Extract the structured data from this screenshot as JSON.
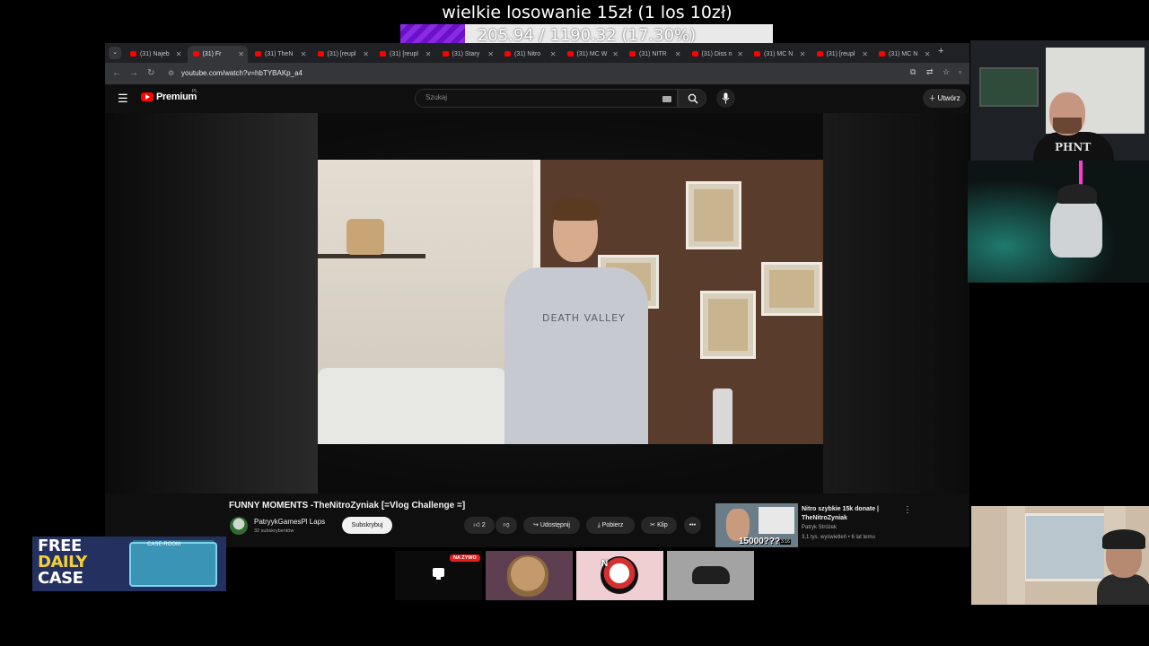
{
  "overlay": {
    "goal_title": "wielkie losowanie 15zł (1 los 10zł)",
    "goal_progress_text": "205.94 / 1190.32 (17.30%)",
    "goal_fraction": 0.173,
    "goal_bar_color": "#8a2be2"
  },
  "browser": {
    "tabs": [
      {
        "label": "(31) Najeb",
        "active": false
      },
      {
        "label": "(31) Fr",
        "active": true
      },
      {
        "label": "(31) TheN",
        "active": false
      },
      {
        "label": "(31) [reupl",
        "active": false
      },
      {
        "label": "(31) [reupl",
        "active": false
      },
      {
        "label": "(31) Stary",
        "active": false
      },
      {
        "label": "(31) Nitro",
        "active": false
      },
      {
        "label": "(31) MC W",
        "active": false
      },
      {
        "label": "(31) NITR",
        "active": false
      },
      {
        "label": "(31) Diss n",
        "active": false
      },
      {
        "label": "(31) MC N",
        "active": false
      },
      {
        "label": "(31) [reupl",
        "active": false
      },
      {
        "label": "(31) MC N",
        "active": false
      }
    ],
    "url": "youtube.com/watch?v=hbTYBAKp_a4"
  },
  "youtube": {
    "logo_text": "Premium",
    "logo_region": "PL",
    "search_placeholder": "Szukaj",
    "create_label": "Utwórz",
    "video": {
      "shirt_text": "DEATH VALLEY",
      "title": "FUNNY MOMENTS -TheNitroZyniak [=Vlog Challenge =]",
      "channel": "PatryykGamesPl Laps",
      "subscribers": "32 subskrybentów",
      "subscribe_label": "Subskrybuj",
      "likes": "2",
      "share_label": "Udostępnij",
      "download_label": "Pobierz",
      "clip_label": "Klip"
    },
    "recommendation": {
      "title": "Nitro szybkie 15k donate | TheNitroZyniak",
      "channel": "Patryk Stróżek",
      "meta": "3,1 tys. wyświetleń • 6 lat temu",
      "thumb_text": "15000???",
      "duration": "3:16"
    }
  },
  "webcams": {
    "cam1_shirt": "PHNT"
  },
  "bottom": {
    "banner_line1": "FREE",
    "banner_line2": "DAILY",
    "banner_line3": "CASE",
    "banner_chest_label": "CASE-ROOM",
    "live_badge": "NA ŻYWO",
    "feat3_text": "N"
  },
  "colors": {
    "youtube_red": "#ff0000",
    "live_red": "#e61d1d",
    "banner_yellow": "#f3d03a"
  }
}
